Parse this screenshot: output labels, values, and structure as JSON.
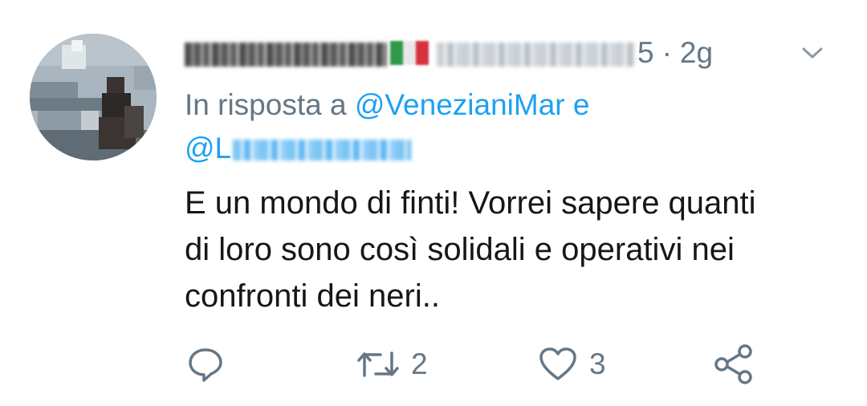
{
  "tweet": {
    "author_name": "marina nardi",
    "author_handle": "@marinanardi5",
    "handle_tail": "5",
    "separator": "·",
    "time": "2g",
    "reply_prefix": "In risposta a",
    "reply_mention_1": "@VenezianiMar",
    "reply_conjunction": "e",
    "reply_mention_2_prefix": "@L",
    "text": "E un mondo di finti! Vorrei sapere quanti\ndi loro sono così solidali e operativi nei\nconfronti dei neri.."
  },
  "actions": {
    "retweet_count": "2",
    "like_count": "3"
  },
  "colors": {
    "secondary_text": "#657786",
    "primary_text": "#14171a",
    "link": "#1da1f2"
  },
  "icons": [
    "chevron-down-icon",
    "reply-icon",
    "retweet-icon",
    "heart-icon",
    "share-icon"
  ]
}
